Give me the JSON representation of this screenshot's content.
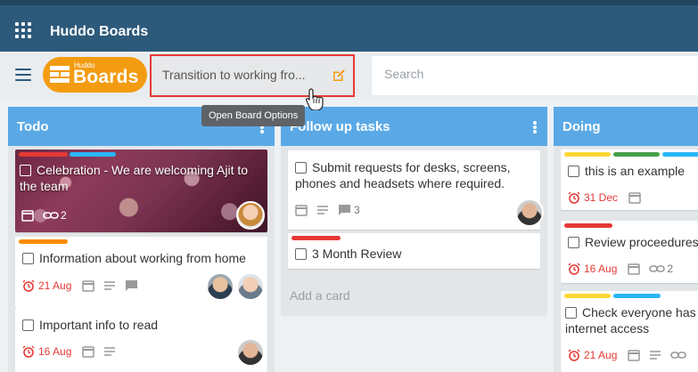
{
  "app": {
    "title": "Huddo Boards"
  },
  "logo": {
    "small": "Huddo",
    "big": "Boards"
  },
  "board": {
    "title": "Transition to working fro..."
  },
  "search": {
    "placeholder": "Search"
  },
  "tooltip": {
    "text": "Open Board Options"
  },
  "lists": [
    {
      "title": "Todo",
      "cards": [
        {
          "title": "Celebration - We are welcoming Ajit to the team",
          "labels": [
            "#e53935",
            "#29b6f6"
          ],
          "links": "2",
          "has_image": true
        },
        {
          "title": "Information about working from home",
          "labels": [
            "#fb8c00"
          ],
          "due": "21 Aug"
        },
        {
          "title": "Important info to read",
          "due": "16 Aug"
        }
      ]
    },
    {
      "title": "Follow up tasks",
      "cards": [
        {
          "title": "Submit requests for desks, screens, phones and headsets where required.",
          "comments": "3"
        },
        {
          "title": "3 Month Review",
          "labels": [
            "#e53935"
          ]
        }
      ],
      "add_card": "Add a card"
    },
    {
      "title": "Doing",
      "cards": [
        {
          "title": "this is an example",
          "labels": [
            "#fdd835",
            "#43a047",
            "#29b6f6"
          ],
          "due": "31 Dec"
        },
        {
          "title": "Review proceedures",
          "labels": [
            "#e53935"
          ],
          "due": "16 Aug",
          "links": "2"
        },
        {
          "title": "Check everyone has internet access",
          "labels": [
            "#fdd835",
            "#29b6f6"
          ],
          "due": "21 Aug"
        }
      ]
    }
  ],
  "colors": {
    "topbar": "#2d5a7b",
    "list_header": "#5aa9e6",
    "logo": "#f39c12",
    "due": "#e53935",
    "highlight": "#e53935"
  },
  "icons": [
    "apps-icon",
    "menu-icon",
    "edit-icon",
    "calendar-icon",
    "link-icon",
    "checklist-icon",
    "comment-icon",
    "alarm-icon",
    "more-vert-icon"
  ]
}
